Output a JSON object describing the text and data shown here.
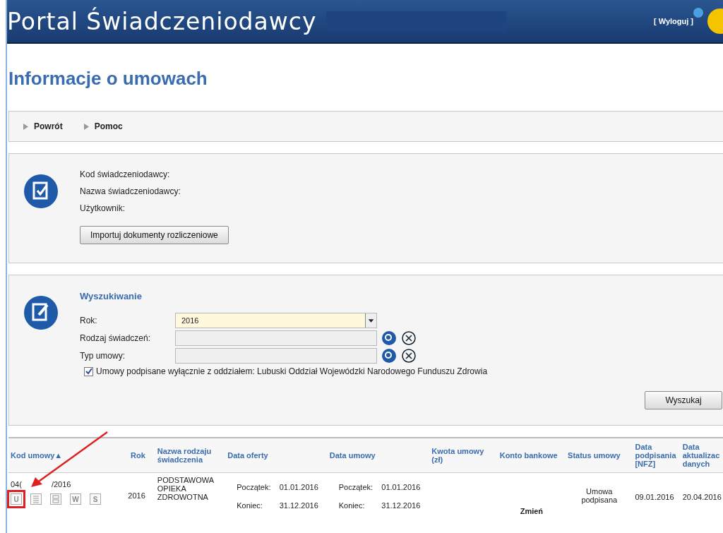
{
  "header": {
    "title": "Portal Świadczeniodawcy",
    "logout": "[ Wyloguj ]"
  },
  "page_title": "Informacje o umowach",
  "nav": [
    "Powrót",
    "Pomoc"
  ],
  "info": {
    "fields": [
      "Kod świadczeniodawcy:",
      "Nazwa świadczeniodawcy:",
      "Użytkownik:"
    ],
    "button": "Importuj dokumenty rozliczeniowe"
  },
  "search": {
    "title": "Wyszukiwanie",
    "fields": [
      {
        "kind": "select",
        "label": "Rok:",
        "value": "2016"
      },
      {
        "kind": "lookup",
        "label": "Rodzaj świadczeń:"
      },
      {
        "kind": "lookup",
        "label": "Typ umowy:"
      }
    ],
    "checkbox": {
      "label": "Umowy podpisane wyłącznie z oddziałem: Lubuski Oddział Wojewódzki Narodowego Funduszu Zdrowia",
      "checked": true
    },
    "button": "Wyszukaj"
  },
  "table": {
    "columns": [
      "Kod umowy▲",
      "Rok",
      "Nazwa rodzaju świadczenia",
      "Data oferty",
      "Data umowy",
      "Kwota umowy (zł)",
      "Konto bankowe",
      "Status umowy",
      "Data podpisania [NFZ]",
      "Data aktualizac danych"
    ],
    "rows": [
      {
        "code_start": "04(",
        "code_end": "/2016",
        "icons": [
          {
            "kind": "letter",
            "text": "U",
            "highlighted": true
          },
          {
            "kind": "doc",
            "highlighted": false
          },
          {
            "kind": "print",
            "highlighted": false
          },
          {
            "kind": "letter",
            "text": "W",
            "highlighted": false
          },
          {
            "kind": "letter",
            "text": "S",
            "highlighted": false
          }
        ],
        "year": "2016",
        "name": "PODSTAWOWA OPIEKA ZDROWOTNA",
        "offer": [
          {
            "label": "Początek:",
            "date": "01.01.2016"
          },
          {
            "label": "Koniec:",
            "date": "31.12.2016"
          }
        ],
        "contract": [
          {
            "label": "Początek:",
            "date": "01.01.2016"
          },
          {
            "label": "Koniec:",
            "date": "31.12.2016"
          }
        ],
        "account_action": "Zmień",
        "status": "Umowa podpisana",
        "signed": "09.01.2016",
        "updated": "20.04.2016"
      }
    ]
  }
}
